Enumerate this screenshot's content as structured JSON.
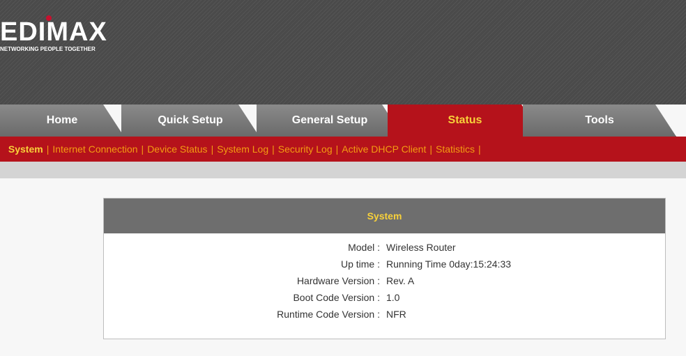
{
  "brand": {
    "logo_text": "EDIMAX",
    "tagline": "NETWORKING PEOPLE TOGETHER"
  },
  "tabs": [
    {
      "label": "Home"
    },
    {
      "label": "Quick Setup"
    },
    {
      "label": "General Setup"
    },
    {
      "label": "Status",
      "active": true
    },
    {
      "label": "Tools"
    }
  ],
  "subnav": [
    {
      "label": "System",
      "active": true
    },
    {
      "label": "Internet Connection"
    },
    {
      "label": "Device Status"
    },
    {
      "label": "System Log"
    },
    {
      "label": "Security Log"
    },
    {
      "label": "Active DHCP Client"
    },
    {
      "label": "Statistics"
    }
  ],
  "subnav_separator": "|",
  "panel": {
    "title": "System",
    "rows": [
      {
        "key": "Model :",
        "value": "Wireless Router"
      },
      {
        "key": "Up time :",
        "value": "Running Time 0day:15:24:33"
      },
      {
        "key": "Hardware Version :",
        "value": "Rev. A"
      },
      {
        "key": "Boot Code Version :",
        "value": "1.0"
      },
      {
        "key": "Runtime Code Version :",
        "value": "NFR"
      }
    ]
  },
  "colors": {
    "accent_red": "#b5121b",
    "accent_yellow": "#f8d13a",
    "link_orange": "#f39c12"
  }
}
